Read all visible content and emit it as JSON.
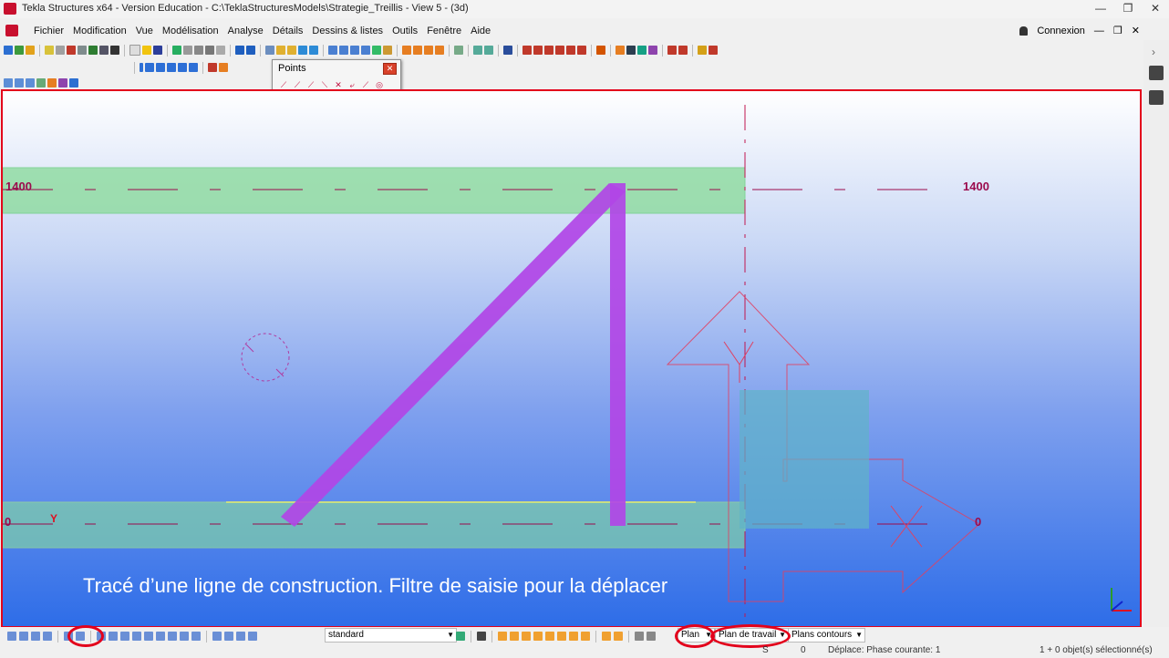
{
  "window": {
    "title": "Tekla Structures x64 - Version Education - C:\\TeklaStructuresModels\\Strategie_Treillis  - View 5 - (3d)",
    "minimize": "—",
    "restore": "❐",
    "close": "✕"
  },
  "menubar": {
    "items": [
      "Fichier",
      "Modification",
      "Vue",
      "Modélisation",
      "Analyse",
      "Détails",
      "Dessins & listes",
      "Outils",
      "Fenêtre",
      "Aide"
    ],
    "connexion": "Connexion"
  },
  "points_panel": {
    "title": "Points",
    "close": "✕"
  },
  "viewport": {
    "grid_top_left": "1400",
    "grid_top_right": "1400",
    "grid_bottom_left": "0",
    "grid_bottom_right": "0",
    "axis_y_label": "Y",
    "caption": "Tracé d’une ligne de construction. Filtre de saisie pour la déplacer",
    "colors": {
      "frame": "#e3001b",
      "beam_band": "#8fdca0",
      "member": "#b145e6",
      "grid_label": "#9b0a4c"
    }
  },
  "statusbar": {
    "filter_value": "standard",
    "plan_value": "Plan",
    "plan_travail_value": "Plan de travail",
    "plans_contours_value": "Plans contours"
  },
  "bottom": {
    "s": "S",
    "count": "0",
    "deplace": "Déplace: Phase courante: 1",
    "selection": "1 + 0 objet(s) sélectionné(s)"
  }
}
